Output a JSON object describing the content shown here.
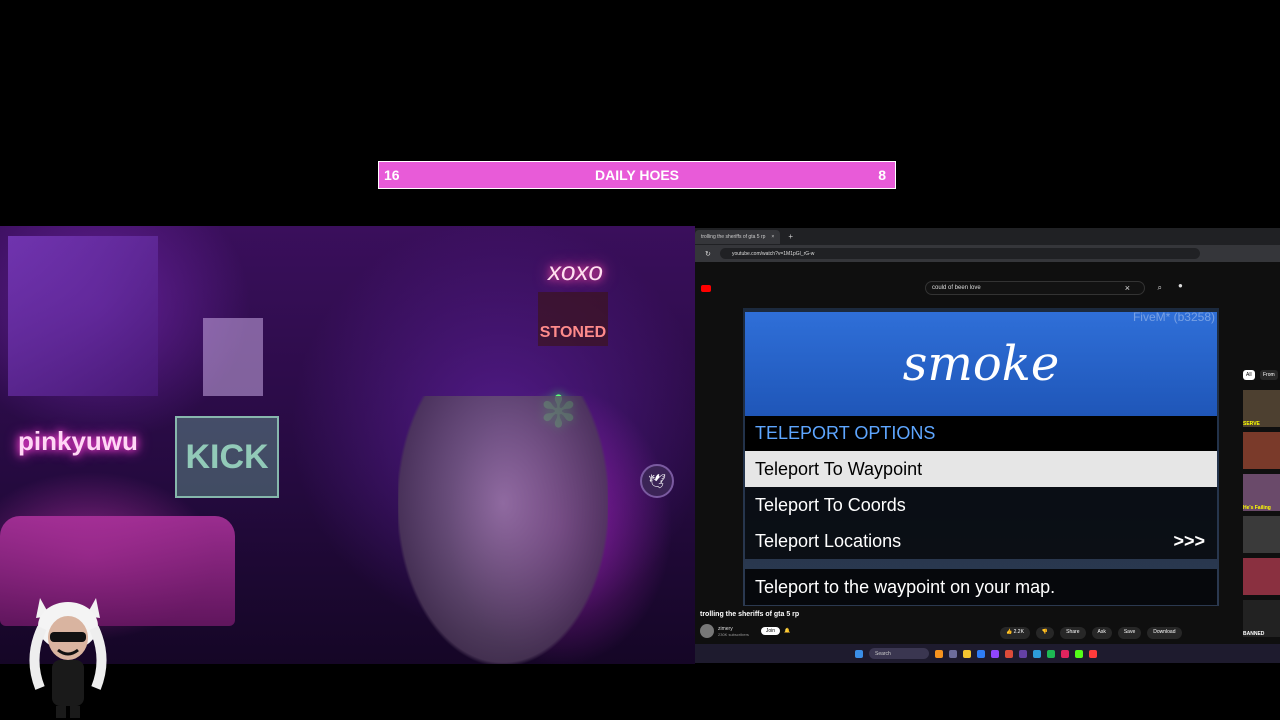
{
  "counter": {
    "left": "16",
    "title": "DAILY HOES",
    "right": "8"
  },
  "webcam": {
    "signs": {
      "pinky": "pinkyuwu",
      "kick": "KICK",
      "xoxo": "xoxo",
      "stoned": "STONED"
    }
  },
  "browser": {
    "tab_title": "trolling the sheriffs of gta 5 rp",
    "new_tab": "+",
    "tab_close": "×",
    "url": "youtube.com/watch?v=1M1pGl_rG-w",
    "search": {
      "value": "could of been love",
      "clear": "×",
      "search_icon": "⌕",
      "mic": "🎙"
    },
    "video": {
      "watermark": "FiveM* (b3258)",
      "menu_header": "smoke",
      "menu_subtitle": "TELEPORT OPTIONS",
      "items": [
        {
          "label": "Teleport To Waypoint",
          "selected": true
        },
        {
          "label": "Teleport To Coords",
          "selected": false
        },
        {
          "label": "Teleport Locations",
          "selected": false,
          "arrow": ">>>"
        }
      ],
      "description": "Teleport to the waypoint on your map."
    },
    "video_title": "trolling the sheriffs of gta 5 rp",
    "channel": {
      "name": "zimery",
      "subs": "230K subscribers",
      "join": "Join"
    },
    "actions": {
      "like": "2.2K",
      "share": "Share",
      "ask": "Ask",
      "save": "Save",
      "download": "Download"
    },
    "sidebar": {
      "chip_all": "All",
      "chip_from": "From",
      "thumb_labels": [
        "SERVE",
        "He's Failing",
        "BANNED"
      ]
    },
    "taskbar": {
      "search": "Search"
    }
  },
  "colors": {
    "counter_bg": "#e85bd8",
    "menu_header": "#2f6fd8",
    "menu_subtitle_text": "#5ea6ff"
  }
}
